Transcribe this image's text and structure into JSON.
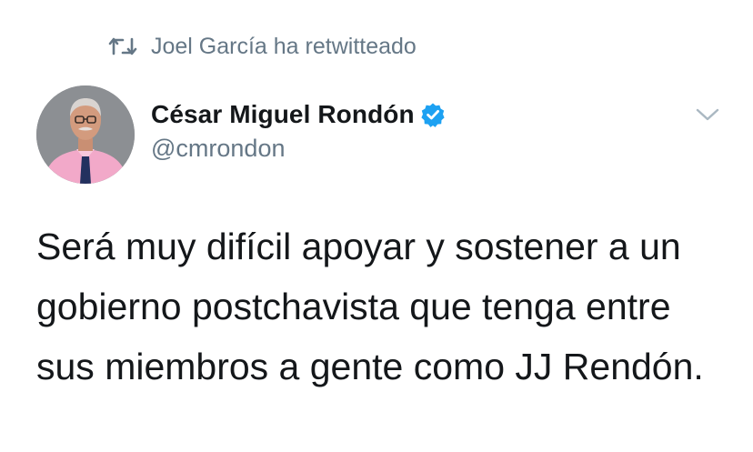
{
  "retweet": {
    "icon": "retweet-icon",
    "text": "Joel García ha retwitteado"
  },
  "author": {
    "avatar_icon": "avatar",
    "display_name": "César Miguel Rondón",
    "verified_icon": "verified-badge-icon",
    "handle": "@cmrondon"
  },
  "menu": {
    "icon": "chevron-down-icon"
  },
  "tweet": {
    "text": "Será muy difícil apoyar y sostener a un gobierno postchavista que tenga entre sus miembros a gente como JJ Rendón."
  },
  "colors": {
    "text_primary": "#14171a",
    "text_secondary": "#657786",
    "verified_blue": "#1da1f2",
    "chevron": "#aab8c2"
  }
}
